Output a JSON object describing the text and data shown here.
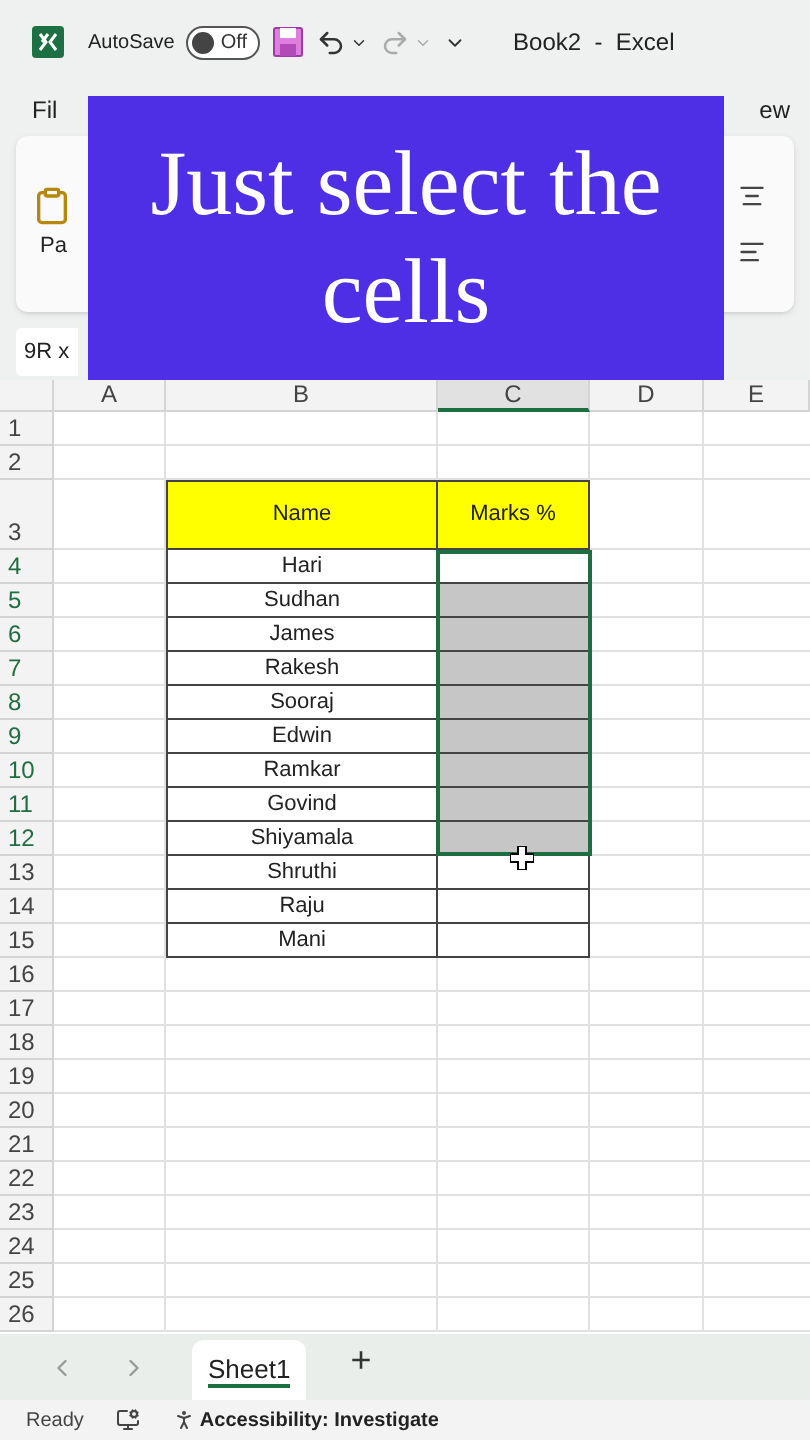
{
  "title_bar": {
    "autosave_label": "AutoSave",
    "autosave_toggle": {
      "label": "Off",
      "on": false
    },
    "document_title": "Book2  -  Excel"
  },
  "ribbon_tabs": [
    {
      "label": "Fil",
      "selected": false
    },
    {
      "label": "ew",
      "selected": false
    }
  ],
  "ribbon": {
    "paste_label": "Pa"
  },
  "name_box": "9R x",
  "caption": "Just select the cells",
  "columns": [
    "A",
    "B",
    "C",
    "D",
    "E"
  ],
  "row_numbers": [
    "1",
    "2",
    "3",
    "4",
    "5",
    "6",
    "7",
    "8",
    "9",
    "10",
    "11",
    "12",
    "13",
    "14",
    "15",
    "16",
    "17",
    "18",
    "19",
    "20",
    "21",
    "22",
    "23",
    "24",
    "25",
    "26"
  ],
  "table": {
    "headers": [
      "Name",
      "Marks %"
    ],
    "rows": [
      {
        "name": "Hari",
        "marks": {
          "selected": true
        }
      },
      {
        "name": "Sudhan",
        "marks": {
          "selected": true
        }
      },
      {
        "name": "James",
        "marks": {
          "selected": true
        }
      },
      {
        "name": "Rakesh",
        "marks": {
          "selected": true
        }
      },
      {
        "name": "Sooraj",
        "marks": {
          "selected": true
        }
      },
      {
        "name": "Edwin",
        "marks": {
          "selected": true
        }
      },
      {
        "name": "Ramkar",
        "marks": {
          "selected": true
        }
      },
      {
        "name": "Govind",
        "marks": {
          "selected": true
        }
      },
      {
        "name": "Shiyamala",
        "marks": {
          "selected": true
        }
      },
      {
        "name": "Shruthi",
        "marks": {
          "selected": false
        }
      },
      {
        "name": "Raju",
        "marks": {
          "selected": false
        }
      },
      {
        "name": "Mani",
        "marks": {
          "selected": false
        }
      }
    ]
  },
  "sheet_tabs": [
    {
      "label": "Sheet1",
      "selected": true
    }
  ],
  "add_sheet": "+",
  "status_bar": {
    "mode": "Ready",
    "accessibility": "Accessibility: Investigate"
  }
}
